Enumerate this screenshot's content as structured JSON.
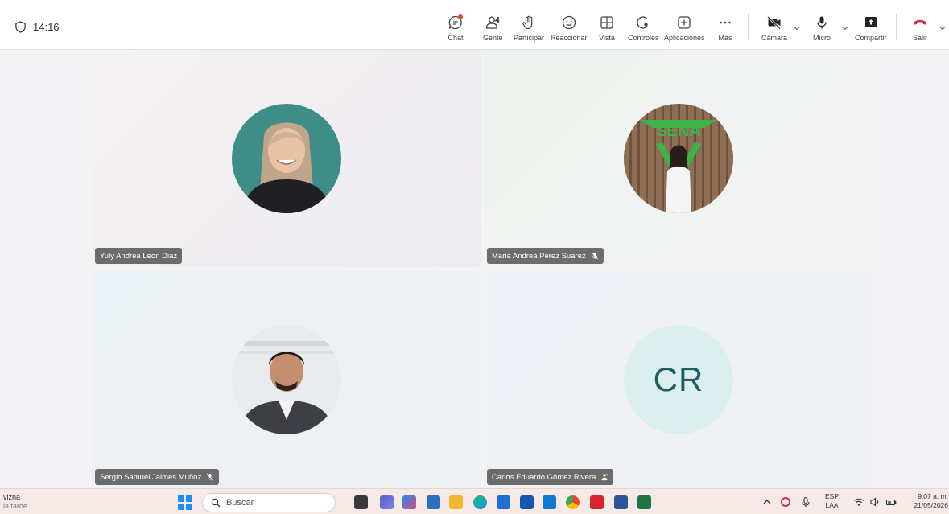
{
  "meeting": {
    "timer": "14:16"
  },
  "toolbar": {
    "chat": "Chat",
    "people": "Gente",
    "people_count": "4",
    "raise": "Participar",
    "react": "Reaccionar",
    "view": "Vista",
    "controls": "Controles",
    "apps": "Aplicaciones",
    "more": "Más",
    "camera": "Cámara",
    "mic": "Micro",
    "share": "Compartir",
    "leave": "Salir"
  },
  "participants": [
    {
      "name": "Yuly Andrea Leon Diaz",
      "muted": false
    },
    {
      "name": "Maria Andrea Perez Suarez",
      "muted": true,
      "logo_text": "SENA"
    },
    {
      "name": "Sergio Samuel Jaimes Muñoz",
      "muted": true
    },
    {
      "name": "Carlos Eduardo Gómez Rivera",
      "initials": "CR",
      "icon": "person-raise-icon"
    }
  ],
  "taskbar": {
    "weather_line1": "vizna",
    "weather_line2": "la tarde",
    "search_placeholder": "Buscar",
    "lang_top": "ESP",
    "lang_bottom": "LAA",
    "time": "9:07 a. m.",
    "date": "21/05/2026"
  },
  "colors": {
    "leave": "#c4314b",
    "accent": "#5b5fc7",
    "initials_bg": "#dcefef",
    "initials_fg": "#1f5f63"
  }
}
